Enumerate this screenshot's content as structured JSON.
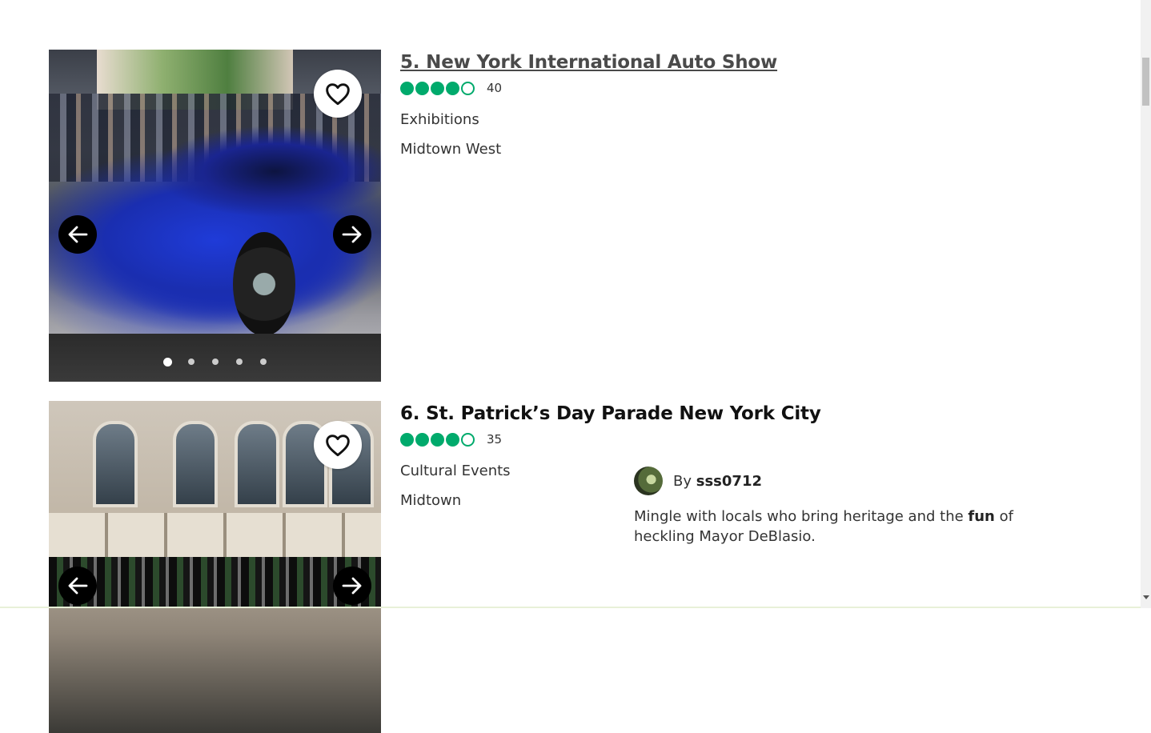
{
  "listings": [
    {
      "title": "5. New York International Auto Show",
      "rating": 4,
      "rating_max": 5,
      "review_count": "40",
      "category": "Exhibitions",
      "neighborhood": "Midtown West",
      "photo_count": 5,
      "active_photo": 1
    },
    {
      "title": "6. St. Patrick’s Day Parade New York City",
      "rating": 4,
      "rating_max": 5,
      "review_count": "35",
      "category": "Cultural Events",
      "neighborhood": "Midtown",
      "review": {
        "by_label": "By",
        "username": "sss0712",
        "text_before": "Mingle with locals who bring heritage and the ",
        "text_bold": "fun",
        "text_after": " of heckling Mayor DeBlasio."
      }
    }
  ],
  "icons": {
    "save": "heart-icon",
    "prev": "arrow-left-icon",
    "next": "arrow-right-icon"
  },
  "colors": {
    "rating_green": "#00aa6c",
    "nav_button": "#000000"
  }
}
